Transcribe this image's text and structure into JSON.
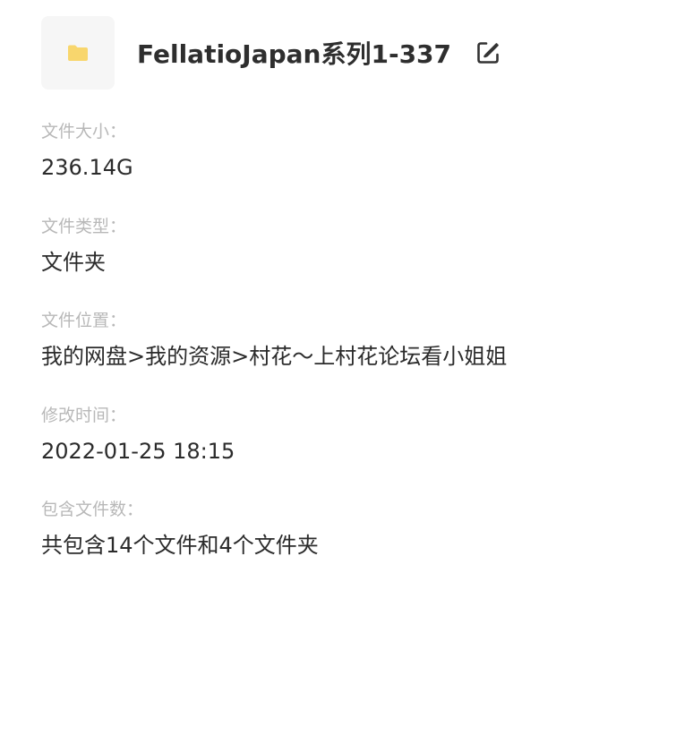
{
  "header": {
    "folder_icon": "folder-icon",
    "folder_icon_color": "#f8d66d",
    "title": "FellatioJapan系列1-337",
    "edit_icon": "edit-icon"
  },
  "details": {
    "size": {
      "label": "文件大小：",
      "value": "236.14G"
    },
    "type": {
      "label": "文件类型：",
      "value": "文件夹"
    },
    "location": {
      "label": "文件位置：",
      "value": "我的网盘>我的资源>村花～上村花论坛看小姐姐"
    },
    "modified": {
      "label": "修改时间：",
      "value": "2022-01-25 18:15"
    },
    "contents": {
      "label": "包含文件数：",
      "value": "共包含14个文件和4个文件夹"
    }
  },
  "colors": {
    "label": "#b8b8b8",
    "value": "#2b2b2b",
    "tile_background": "#f6f6f6"
  }
}
